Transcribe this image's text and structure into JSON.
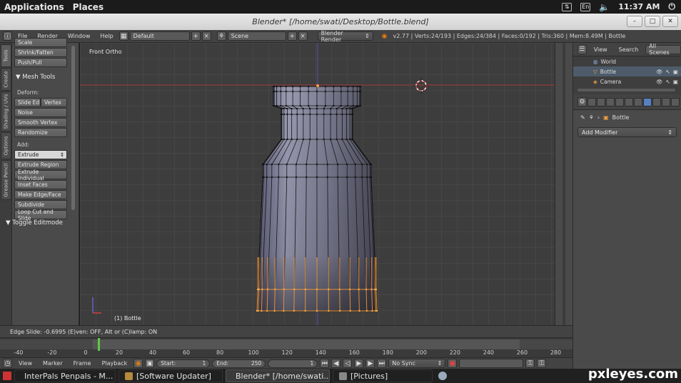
{
  "gnome_panel": {
    "applications": "Applications",
    "places": "Places",
    "keyboard": "En",
    "clock": "11:37 AM"
  },
  "window": {
    "title": "Blender* [/home/swati/Desktop/Bottle.blend]",
    "minimize": "–",
    "maximize": "□",
    "close": "✕"
  },
  "info_header": {
    "menus": [
      "File",
      "Render",
      "Window",
      "Help"
    ],
    "layout": "Default",
    "scene": "Scene",
    "engine": "Blender Render",
    "stats": "v2.77 | Verts:24/193 | Edges:24/384 | Faces:0/192 | Tris:360 | Mem:8.49M | Bottle"
  },
  "toolshelf": {
    "tabs": [
      "Tools",
      "Create",
      "Shading / UVs",
      "Options",
      "Grease Pencil"
    ],
    "top_buttons": [
      "Scale",
      "Shrink/Fatten",
      "Push/Pull"
    ],
    "mesh_tools_title": "Mesh Tools",
    "deform_label": "Deform:",
    "slide_edge": "Slide Ed",
    "vertex": "Vertex",
    "noise": "Noise",
    "smooth_vertex": "Smooth Vertex",
    "randomize": "Randomize",
    "add_label": "Add:",
    "extrude": "Extrude",
    "extrude_region": "Extrude Region",
    "extrude_individual": "Extrude Individual",
    "inset_faces": "Inset Faces",
    "make_edge_face": "Make Edge/Face",
    "subdivide": "Subdivide",
    "loop_cut": "Loop Cut and Slide",
    "toggle_editmode": "Toggle Editmode"
  },
  "viewport": {
    "view_label": "Front Ortho",
    "object_label": "(1) Bottle",
    "colors": {
      "background": "#3d3d3d",
      "grid": "#464646",
      "bottle": "#8c8ca0",
      "selection": "#ff9a2e",
      "x_axis": "#c24444",
      "z_axis": "#6b5fc4"
    }
  },
  "status": {
    "edge_slide": "Edge Slide: -0.6995 (E)ven: OFF, Alt or (C)lamp: ON"
  },
  "timeline": {
    "ticks": [
      -40,
      -20,
      0,
      20,
      40,
      60,
      80,
      100,
      120,
      140,
      160,
      180,
      200,
      220,
      240,
      260,
      280
    ],
    "current_frame_marker": 0
  },
  "timeline_header": {
    "menus": [
      "View",
      "Marker",
      "Frame",
      "Playback"
    ],
    "start_label": "Start:",
    "start_value": "1",
    "end_label": "End:",
    "end_value": "250",
    "current_frame": "1",
    "sync": "No Sync"
  },
  "outliner": {
    "view": "View",
    "search": "Search",
    "all_scenes": "All Scenes",
    "items": [
      "World",
      "Bottle",
      "Camera"
    ]
  },
  "properties": {
    "object_name": "Bottle",
    "add_modifier": "Add Modifier"
  },
  "taskbar": {
    "tasks": [
      "InterPals Penpals - M...",
      "[Software Updater]",
      "Blender* [/home/swati...",
      "[Pictures]"
    ]
  },
  "watermark": "pxleyes.com"
}
